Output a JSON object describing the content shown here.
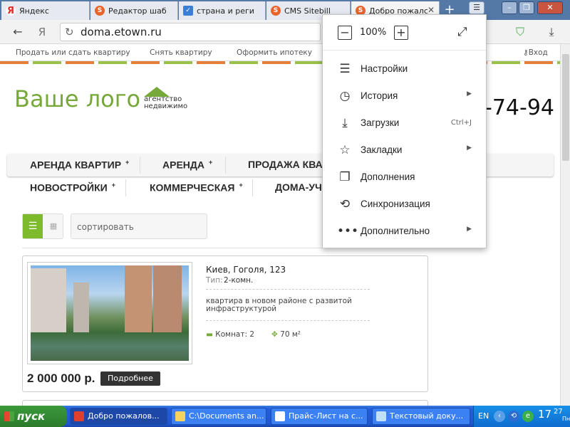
{
  "browser": {
    "tabs": [
      {
        "label": "Яндекс",
        "icon": "yandex-icon",
        "active": false
      },
      {
        "label": "Редактор шаб",
        "icon": "sitebill-icon",
        "active": false
      },
      {
        "label": "страна и реги",
        "icon": "checkmark-icon",
        "active": false
      },
      {
        "label": "CMS Sitebill",
        "icon": "sitebill-icon",
        "active": false
      },
      {
        "label": "Добро пожалс",
        "icon": "sitebill-icon",
        "active": true
      }
    ],
    "new_tab": "+",
    "url": "doma.etown.ru"
  },
  "site": {
    "topnav": [
      "Продать или сдать квартиру",
      "Снять квартиру",
      "Оформить ипотеку"
    ],
    "login": "Вход",
    "logo": "Ваше лого",
    "agency_line1": "агентство",
    "agency_line2": "недвижимо",
    "phone": "-74-94",
    "menu_row1": [
      "АРЕНДА КВАРТИР",
      "АРЕНДА",
      "ПРОДАЖА КВА"
    ],
    "menu_row2": [
      "НОВОСТРОЙКИ",
      "КОММЕРЧЕСКАЯ",
      "ДОМА-УЧ"
    ],
    "menu_plus": "+",
    "sort_placeholder": "сортировать",
    "listing": {
      "address": "Киев, Гоголя, 123",
      "type_label": "Тип:",
      "type_value": "2-комн.",
      "description": "квартира в новом районе с развитой инфраструктурой",
      "rooms": "Комнат: 2",
      "area": "70 м²",
      "price": "2 000 000 р.",
      "details_button": "Подробнее"
    }
  },
  "menu": {
    "zoom": "100%",
    "items": [
      {
        "label": "Настройки",
        "icon": "settings-sliders-icon",
        "submenu": false,
        "shortcut": ""
      },
      {
        "label": "История",
        "icon": "clock-icon",
        "submenu": true,
        "shortcut": ""
      },
      {
        "label": "Загрузки",
        "icon": "download-icon",
        "submenu": false,
        "shortcut": "Ctrl+J"
      },
      {
        "label": "Закладки",
        "icon": "star-icon",
        "submenu": true,
        "shortcut": ""
      },
      {
        "label": "Дополнения",
        "icon": "extensions-icon",
        "submenu": false,
        "shortcut": ""
      },
      {
        "label": "Синхронизация",
        "icon": "sync-icon",
        "submenu": false,
        "shortcut": ""
      },
      {
        "label": "Дополнительно",
        "icon": "more-dots-icon",
        "submenu": true,
        "shortcut": ""
      }
    ]
  },
  "taskbar": {
    "start": "пуск",
    "buttons": [
      {
        "label": "Добро пожалов...",
        "active": true
      },
      {
        "label": "C:\\Documents an...",
        "active": false
      },
      {
        "label": "Прайс-Лист на с...",
        "active": false
      },
      {
        "label": "Текстовый доку...",
        "active": false
      }
    ],
    "lang": "EN",
    "time": "17",
    "time_min": "27",
    "day": "Пн"
  },
  "colors": {
    "accent_green": "#7dbb2c",
    "taskbar_blue": "#245edb",
    "tab_bar": "#5479a6"
  }
}
